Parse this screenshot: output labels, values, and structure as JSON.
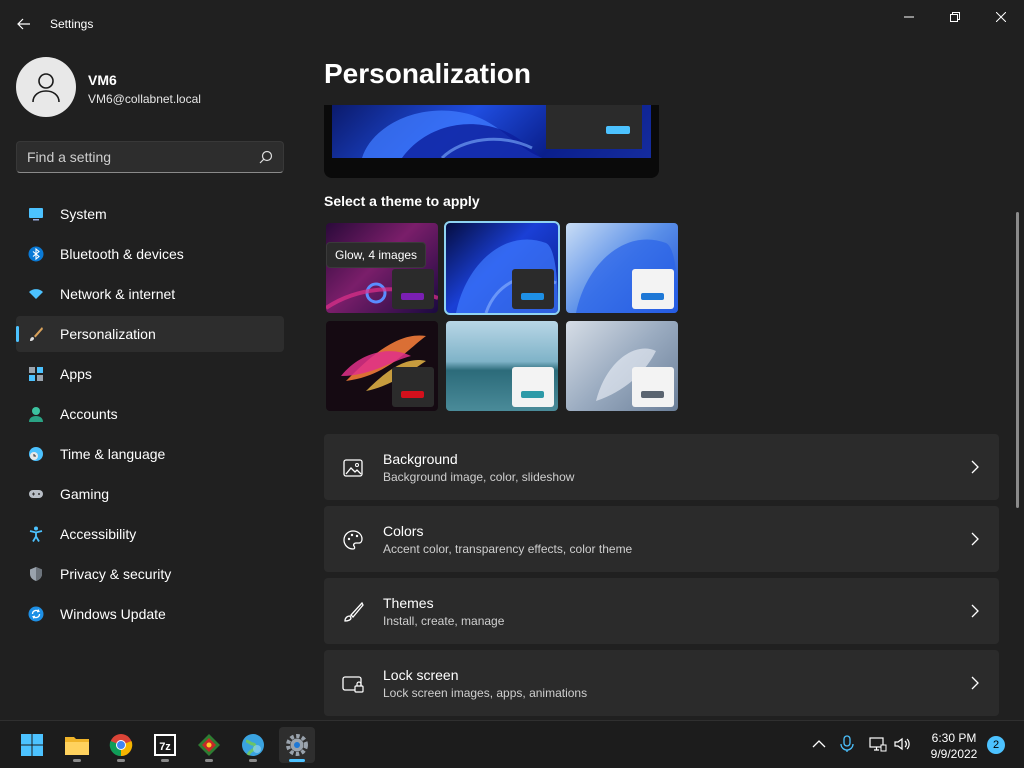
{
  "window": {
    "title": "Settings",
    "back_icon": "back-arrow-icon",
    "controls": [
      "minimize-icon",
      "maximize-icon",
      "close-icon"
    ]
  },
  "user": {
    "name": "VM6",
    "email": "VM6@collabnet.local"
  },
  "search": {
    "placeholder": "Find a setting"
  },
  "sidebar": {
    "items": [
      {
        "label": "System",
        "icon": "system-icon",
        "selected": false
      },
      {
        "label": "Bluetooth & devices",
        "icon": "bluetooth-icon",
        "selected": false
      },
      {
        "label": "Network & internet",
        "icon": "wifi-icon",
        "selected": false
      },
      {
        "label": "Personalization",
        "icon": "brush-icon",
        "selected": true
      },
      {
        "label": "Apps",
        "icon": "apps-icon",
        "selected": false
      },
      {
        "label": "Accounts",
        "icon": "account-icon",
        "selected": false
      },
      {
        "label": "Time & language",
        "icon": "globe-clock-icon",
        "selected": false
      },
      {
        "label": "Gaming",
        "icon": "gamepad-icon",
        "selected": false
      },
      {
        "label": "Accessibility",
        "icon": "accessibility-icon",
        "selected": false
      },
      {
        "label": "Privacy & security",
        "icon": "shield-icon",
        "selected": false
      },
      {
        "label": "Windows Update",
        "icon": "update-icon",
        "selected": false
      }
    ]
  },
  "main": {
    "title": "Personalization",
    "themes_heading": "Select a theme to apply",
    "theme_tooltip": "Glow, 4 images",
    "themes": [
      {
        "name": "glow",
        "selected": false
      },
      {
        "name": "windows-dark",
        "selected": true
      },
      {
        "name": "windows-light",
        "selected": false
      },
      {
        "name": "captured-motion",
        "selected": false
      },
      {
        "name": "sunrise",
        "selected": false
      },
      {
        "name": "flow",
        "selected": false
      }
    ],
    "cards": [
      {
        "title": "Background",
        "subtitle": "Background image, color, slideshow",
        "icon": "image-icon"
      },
      {
        "title": "Colors",
        "subtitle": "Accent color, transparency effects, color theme",
        "icon": "palette-icon"
      },
      {
        "title": "Themes",
        "subtitle": "Install, create, manage",
        "icon": "brush-icon"
      },
      {
        "title": "Lock screen",
        "subtitle": "Lock screen images, apps, animations",
        "icon": "lock-screen-icon"
      }
    ]
  },
  "taskbar": {
    "apps": [
      "start-icon",
      "file-explorer-icon",
      "chrome-icon",
      "7zip-icon",
      "app-icon",
      "globe-app-icon",
      "settings-icon"
    ],
    "time": "6:30 PM",
    "date": "9/9/2022",
    "notifications": "2"
  },
  "colors": {
    "accent": "#4cc2ff",
    "background": "#202020",
    "card": "#2b2b2b"
  }
}
